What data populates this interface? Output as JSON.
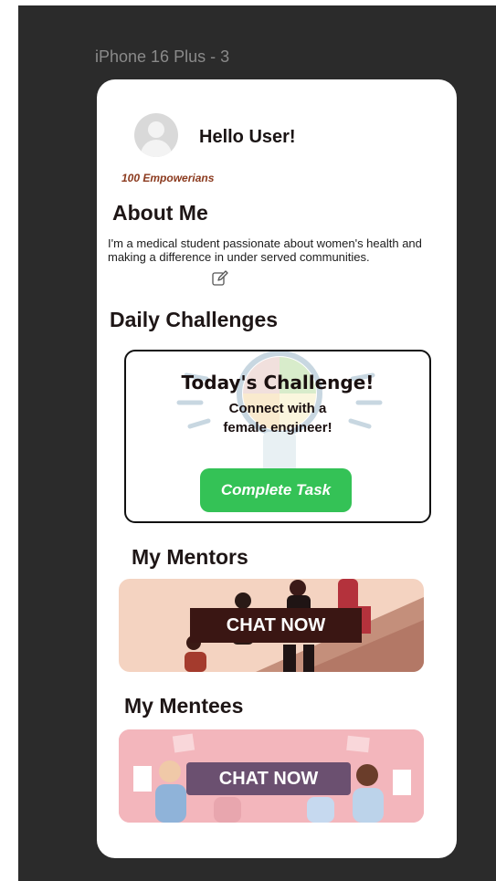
{
  "frame": {
    "label": "iPhone 16 Plus - 3"
  },
  "header": {
    "greeting": "Hello User!",
    "points": "100 Empowerians"
  },
  "about": {
    "title": "About Me",
    "text": "I'm a medical student passionate about women's health and making a difference in under served communities."
  },
  "daily": {
    "title": "Daily Challenges",
    "card_title": "Today's Challenge!",
    "description": "Connect with a female engineer!",
    "button_label": "Complete Task"
  },
  "mentors": {
    "title": "My Mentors",
    "button_label": "CHAT NOW"
  },
  "mentees": {
    "title": "My Mentees",
    "button_label": "CHAT NOW"
  },
  "colors": {
    "canvas": "#2b2b2b",
    "accent_green": "#34c256",
    "points": "#8b3a1e",
    "mentors_button": "#3a1613",
    "mentees_button": "#6b5070"
  },
  "icons": [
    "avatar",
    "edit-icon",
    "lightbulb-icon"
  ]
}
